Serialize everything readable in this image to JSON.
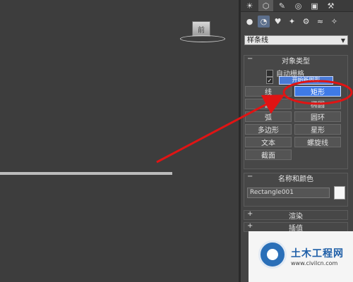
{
  "viewport": {
    "view_cube_glyph": "前"
  },
  "panel": {
    "tabs": [
      "☀",
      "⬡",
      "✎",
      "◎",
      "▣",
      "⚒"
    ],
    "create_icons": [
      "●",
      "◔",
      "♥",
      "✦",
      "⚙",
      "≈",
      "✧"
    ],
    "category_dropdown": "样条线",
    "object_type": {
      "title": "对象类型",
      "collapse_sign": "−",
      "auto_grid": "自动栅格",
      "start_new_shape": "开始新图形",
      "buttons": [
        "线",
        "矩形",
        "圆",
        "椭圆",
        "弧",
        "圆环",
        "多边形",
        "星形",
        "文本",
        "螺旋线",
        "截面"
      ]
    },
    "name_color": {
      "title": "名称和颜色",
      "collapse_sign": "−",
      "object_name": "Rectangle001"
    },
    "rendering": {
      "title": "渲染",
      "expand_sign": "+"
    },
    "interpolation": {
      "title": "插值",
      "expand_sign": "+"
    }
  },
  "watermark": {
    "title": "土木工程网",
    "url": "www.civilcn.com"
  },
  "colors": {
    "selected_button": "#3f7ae6",
    "annotation": "#e01414"
  }
}
